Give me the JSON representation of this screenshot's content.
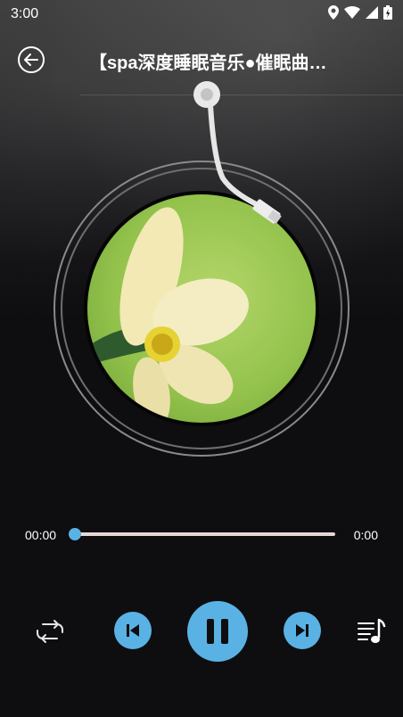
{
  "status": {
    "time": "3:00"
  },
  "header": {
    "title": "【spa深度睡眠音乐●催眠曲…"
  },
  "player": {
    "current_time": "00:00",
    "total_time": "0:00",
    "progress": 0.0
  },
  "colors": {
    "accent": "#5ab2e4",
    "background": "#0e0d10"
  },
  "icons": {
    "back": "back-arrow-icon",
    "repeat": "repeat-icon",
    "previous": "previous-icon",
    "pause": "pause-icon",
    "next": "next-icon",
    "playlist": "playlist-icon"
  }
}
